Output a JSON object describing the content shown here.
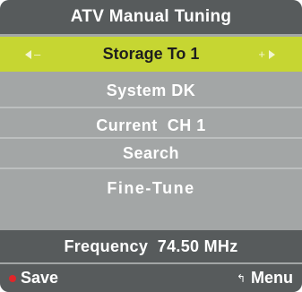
{
  "title": "ATV Manual Tuning",
  "selected_item": {
    "label": "Storage To 1",
    "left_symbol": "–",
    "right_symbol": "+"
  },
  "items": [
    {
      "label": "System DK"
    },
    {
      "label": "Current  CH 1"
    },
    {
      "label": "Search"
    },
    {
      "label": "Fine-Tune"
    }
  ],
  "frequency": "Frequency  74.50 MHz",
  "footer": {
    "save_label": "Save",
    "menu_label": "Menu",
    "menu_icon": "↰"
  },
  "colors": {
    "panel": "#a3a6a6",
    "bar": "#575b5c",
    "highlight": "#c6d632",
    "save_dot": "#e0262a"
  }
}
